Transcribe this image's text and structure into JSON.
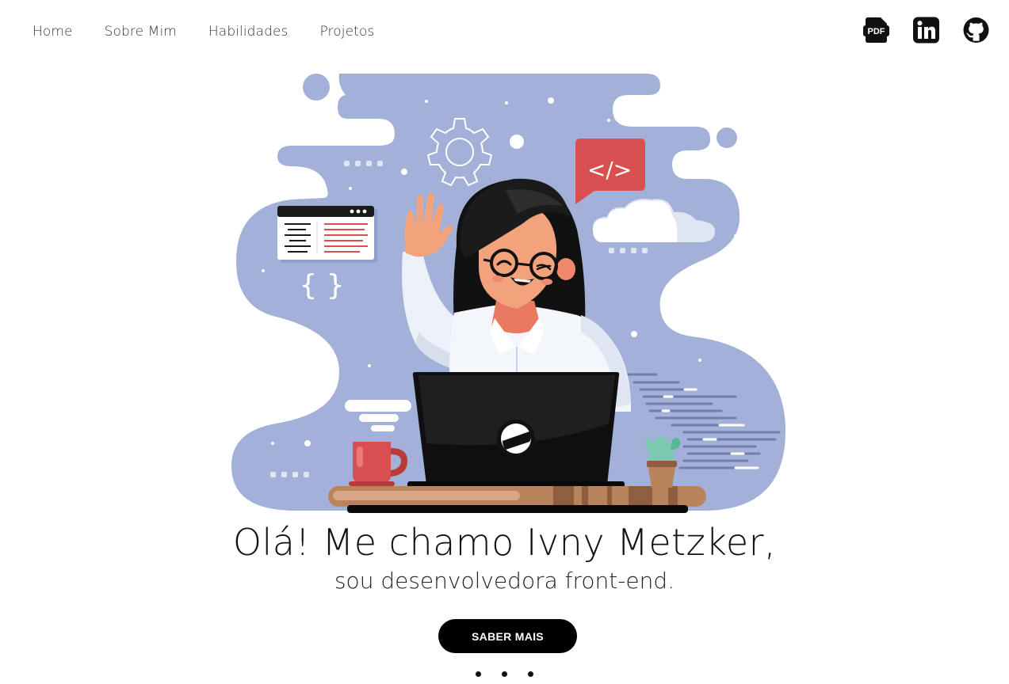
{
  "nav": {
    "items": [
      {
        "label": "Home"
      },
      {
        "label": "Sobre Mim"
      },
      {
        "label": "Habilidades"
      },
      {
        "label": "Projetos"
      }
    ]
  },
  "social": {
    "pdf_text": "PDF",
    "linkedin_text": "in",
    "icons": [
      "pdf-icon",
      "linkedin-icon",
      "github-icon"
    ]
  },
  "hero": {
    "code_tag": "</>",
    "braces": "{ }",
    "title": "Olá! Me chamo Ivny Metzker,",
    "subtitle": "sou desenvolvedora front-end.",
    "cta_label": "SABER MAIS"
  },
  "colors": {
    "blob": "#a3b1d8",
    "accent_red": "#d94f4f",
    "hair": "#111111",
    "skin": "#f3a37c",
    "desk": "#b9835b",
    "cactus": "#7cc9b1",
    "button_bg": "#000000",
    "button_text": "#ffffff"
  }
}
